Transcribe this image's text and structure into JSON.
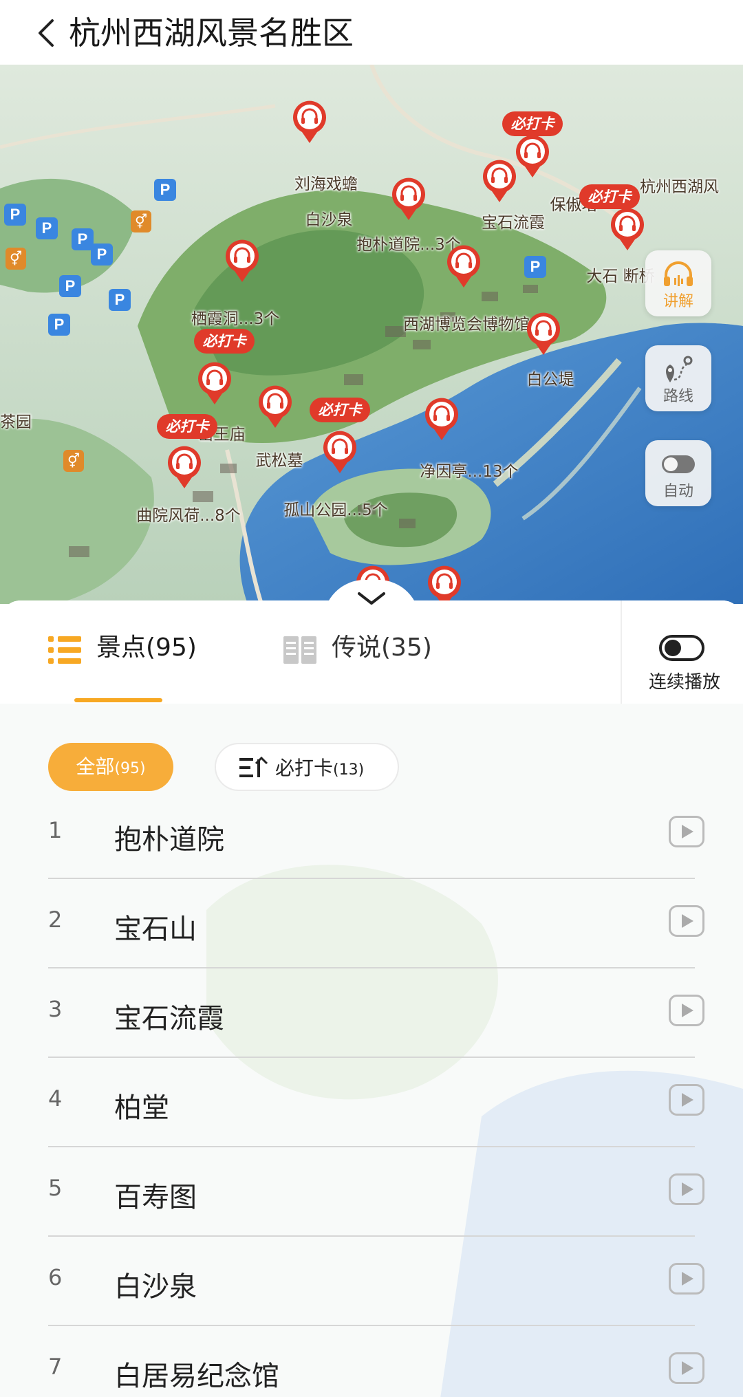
{
  "header": {
    "title": "杭州西湖风景名胜区",
    "back_icon": "chevron-left-icon"
  },
  "map": {
    "pois": [
      {
        "name": "刘海戏蟾",
        "checkin": false
      },
      {
        "name": "白沙泉",
        "checkin": false
      },
      {
        "name": "抱朴道院...3个",
        "checkin": false
      },
      {
        "name": "宝石流霞",
        "checkin": false
      },
      {
        "name": "保俶塔",
        "checkin": true
      },
      {
        "name": "杭州西湖风",
        "checkin": false
      },
      {
        "name": "大石 断桥",
        "checkin": true
      },
      {
        "name": "栖霞洞...3个",
        "checkin": false
      },
      {
        "name": "西湖博览会博物馆",
        "checkin": false
      },
      {
        "name": "白公堤",
        "checkin": false
      },
      {
        "name": "岳王庙",
        "checkin": true
      },
      {
        "name": "武松墓",
        "checkin": false
      },
      {
        "name": "孤山公园...5个",
        "checkin": true
      },
      {
        "name": "净因亭...13个",
        "checkin": false
      },
      {
        "name": "曲院风荷...8个",
        "checkin": true
      },
      {
        "name": "茶园",
        "checkin": false
      }
    ],
    "checkin_badge": "必打卡",
    "parking_symbol": "P",
    "side_buttons": {
      "explain": "讲解",
      "route": "路线",
      "auto": "自动"
    }
  },
  "tabs": {
    "spots_label": "景点(95)",
    "legends_label": "传说(35)",
    "continuous_play": "连续播放"
  },
  "filters": {
    "all_label": "全部",
    "all_count": "(95)",
    "checkin_label": "必打卡",
    "checkin_count": "(13)"
  },
  "spots": [
    {
      "num": "1",
      "name": "抱朴道院"
    },
    {
      "num": "2",
      "name": "宝石山"
    },
    {
      "num": "3",
      "name": "宝石流霞"
    },
    {
      "num": "4",
      "name": "柏堂"
    },
    {
      "num": "5",
      "name": "百寿图"
    },
    {
      "num": "6",
      "name": "白沙泉"
    },
    {
      "num": "7",
      "name": "白居易纪念馆"
    }
  ],
  "colors": {
    "accent": "#f7a823",
    "pin_red": "#e03a2a",
    "lake_blue": "#3f7fc6",
    "land_green": "#7fae6a"
  }
}
